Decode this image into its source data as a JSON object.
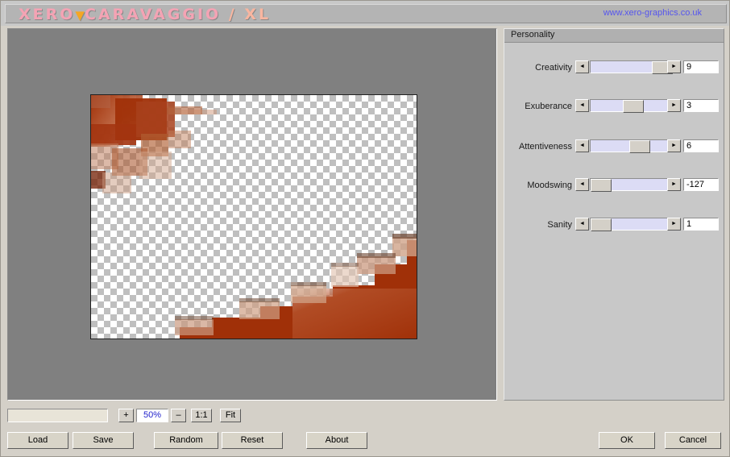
{
  "titlebar": {
    "brand_part1": "XERO",
    "brand_triangle": "▼",
    "brand_part2": "CARAVAGGIO",
    "brand_part3": "/ XL",
    "site_url": "www.xero-graphics.co.uk"
  },
  "panel": {
    "header": "Personality",
    "sliders": [
      {
        "label": "Creativity",
        "value": "9",
        "fill_pct": 87
      },
      {
        "label": "Exuberance",
        "value": "3",
        "fill_pct": 45
      },
      {
        "label": "Attentiveness",
        "value": "6",
        "fill_pct": 52
      },
      {
        "label": "Moodswing",
        "value": "-127",
        "fill_pct": 2
      },
      {
        "label": "Sanity",
        "value": "1",
        "fill_pct": 2
      }
    ],
    "arrow_left": "◄",
    "arrow_right": "►"
  },
  "zoombar": {
    "status_text": "",
    "plus_label": "+",
    "zoom_level": "50%",
    "minus_label": "–",
    "one_to_one_label": "1:1",
    "fit_label": "Fit"
  },
  "buttons": {
    "load": "Load",
    "save": "Save",
    "random": "Random",
    "reset": "Reset",
    "about": "About",
    "ok": "OK",
    "cancel": "Cancel"
  },
  "colors": {
    "viewport_background": "#808080",
    "panel_background": "#c8c8c8",
    "button_face": "#d4d0c8",
    "slider_track": "#dcdcf5",
    "artwork_rust": "#a03008",
    "brand_pink": "#f4a3b4",
    "brand_orange": "#f5a623",
    "url_blue": "#5555ee",
    "zoom_text_blue": "#2222cc"
  },
  "canvas": {
    "label": "transparent-checkerboard-canvas",
    "artwork_description": "blocky rust-colored pixel shapes on transparency checkerboard"
  }
}
